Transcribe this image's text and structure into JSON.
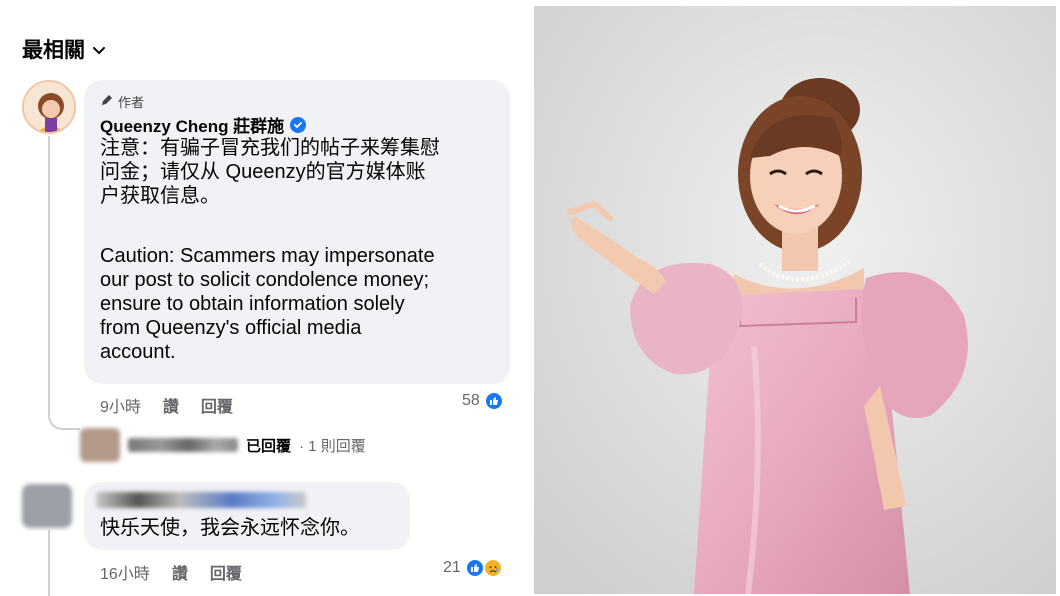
{
  "sort": {
    "label": "最相關",
    "chevron": "⌄"
  },
  "author_comment": {
    "author_badge": "作者",
    "author_name": "Queenzy Cheng 莊群施",
    "text_zh": "注意：有骗子冒充我们的帖子来筹集慰\n问金；请仅从 Queenzy的官方媒体账\n户获取信息。",
    "text_en": "Caution: Scammers may impersonate\nour post to solicit condolence money;\nensure to obtain information solely\nfrom Queenzy's official media\naccount.",
    "time": "9小時",
    "like_action": "讚",
    "reply_action": "回覆",
    "reaction_count": "58"
  },
  "replies_summary": {
    "replied_text": "已回覆",
    "reply_count": "· 1 則回覆"
  },
  "second_comment": {
    "text": "快乐天使，我会永远怀念你。",
    "time": "16小時",
    "like_action": "讚",
    "reply_action": "回覆",
    "reaction_count": "21"
  },
  "colors": {
    "facebook_blue": "#1877f2",
    "bubble_bg": "#f0f2f5",
    "meta_gray": "#65676b",
    "dress_pink": "#e8a9bf",
    "backdrop_gray": "#e6e6e6"
  },
  "icons": [
    "chevron-down-icon",
    "pen-icon",
    "verified-badge-icon",
    "like-reaction-icon",
    "sad-reaction-icon"
  ]
}
